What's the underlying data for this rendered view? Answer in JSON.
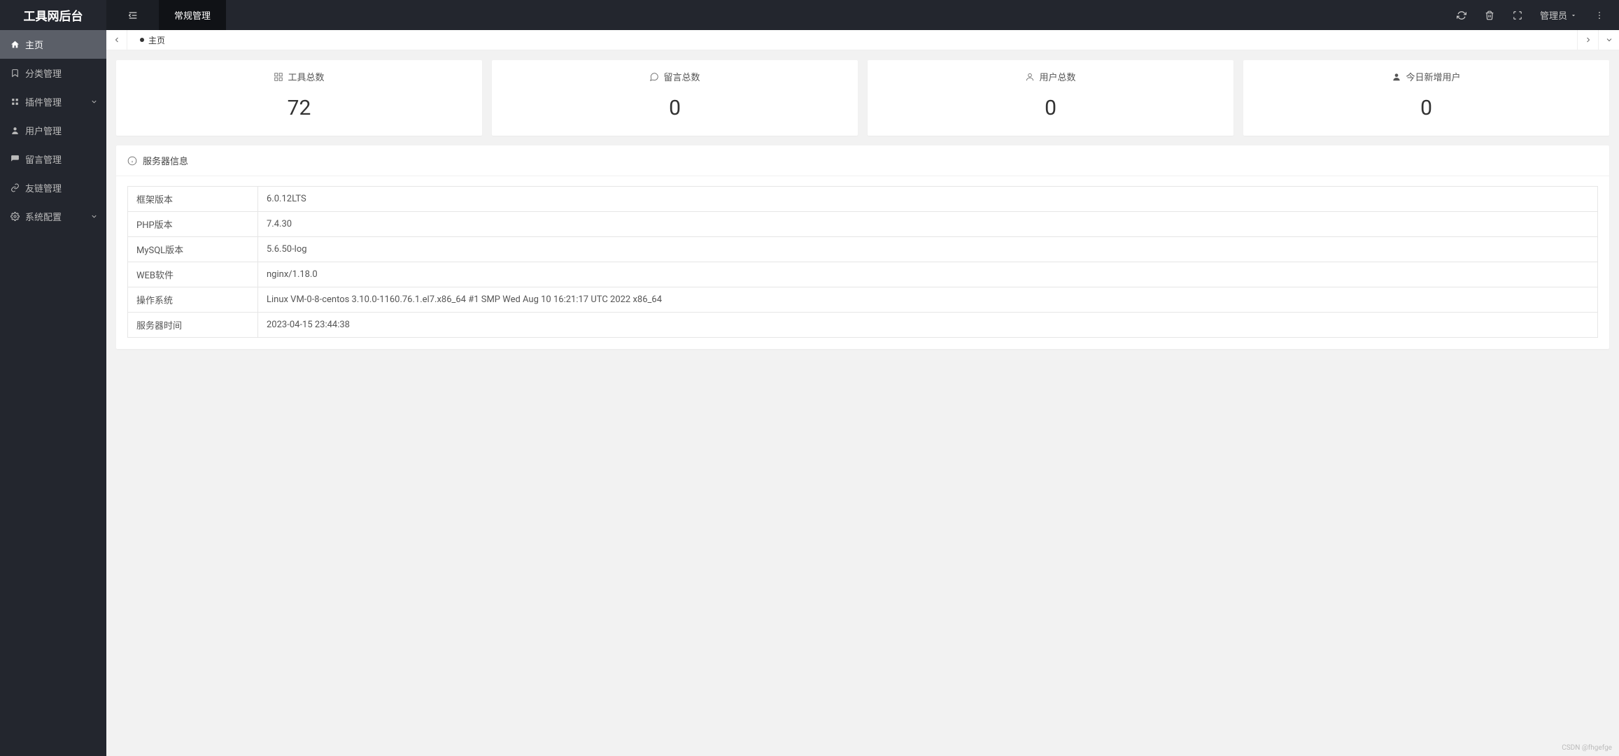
{
  "header": {
    "logo": "工具网后台",
    "nav_active": "常规管理",
    "user_label": "管理员"
  },
  "sidebar": {
    "items": [
      {
        "label": "主页",
        "icon": "home",
        "active": true
      },
      {
        "label": "分类管理",
        "icon": "bookmark"
      },
      {
        "label": "插件管理",
        "icon": "plugin",
        "has_children": true
      },
      {
        "label": "用户管理",
        "icon": "user"
      },
      {
        "label": "留言管理",
        "icon": "comments"
      },
      {
        "label": "友链管理",
        "icon": "link"
      },
      {
        "label": "系统配置",
        "icon": "cogs",
        "has_children": true
      }
    ]
  },
  "tabs": {
    "active": "主页"
  },
  "stats": [
    {
      "title": "工具总数",
      "value": "72",
      "icon": "apps"
    },
    {
      "title": "留言总数",
      "value": "0",
      "icon": "message"
    },
    {
      "title": "用户总数",
      "value": "0",
      "icon": "person"
    },
    {
      "title": "今日新增用户",
      "value": "0",
      "icon": "person-solid"
    }
  ],
  "server_info": {
    "title": "服务器信息",
    "rows": [
      {
        "label": "框架版本",
        "value": "6.0.12LTS"
      },
      {
        "label": "PHP版本",
        "value": "7.4.30"
      },
      {
        "label": "MySQL版本",
        "value": "5.6.50-log"
      },
      {
        "label": "WEB软件",
        "value": "nginx/1.18.0"
      },
      {
        "label": "操作系统",
        "value": "Linux VM-0-8-centos 3.10.0-1160.76.1.el7.x86_64 #1 SMP Wed Aug 10 16:21:17 UTC 2022 x86_64"
      },
      {
        "label": "服务器时间",
        "value": "2023-04-15 23:44:38"
      }
    ]
  },
  "watermark": "CSDN @fhgefge"
}
